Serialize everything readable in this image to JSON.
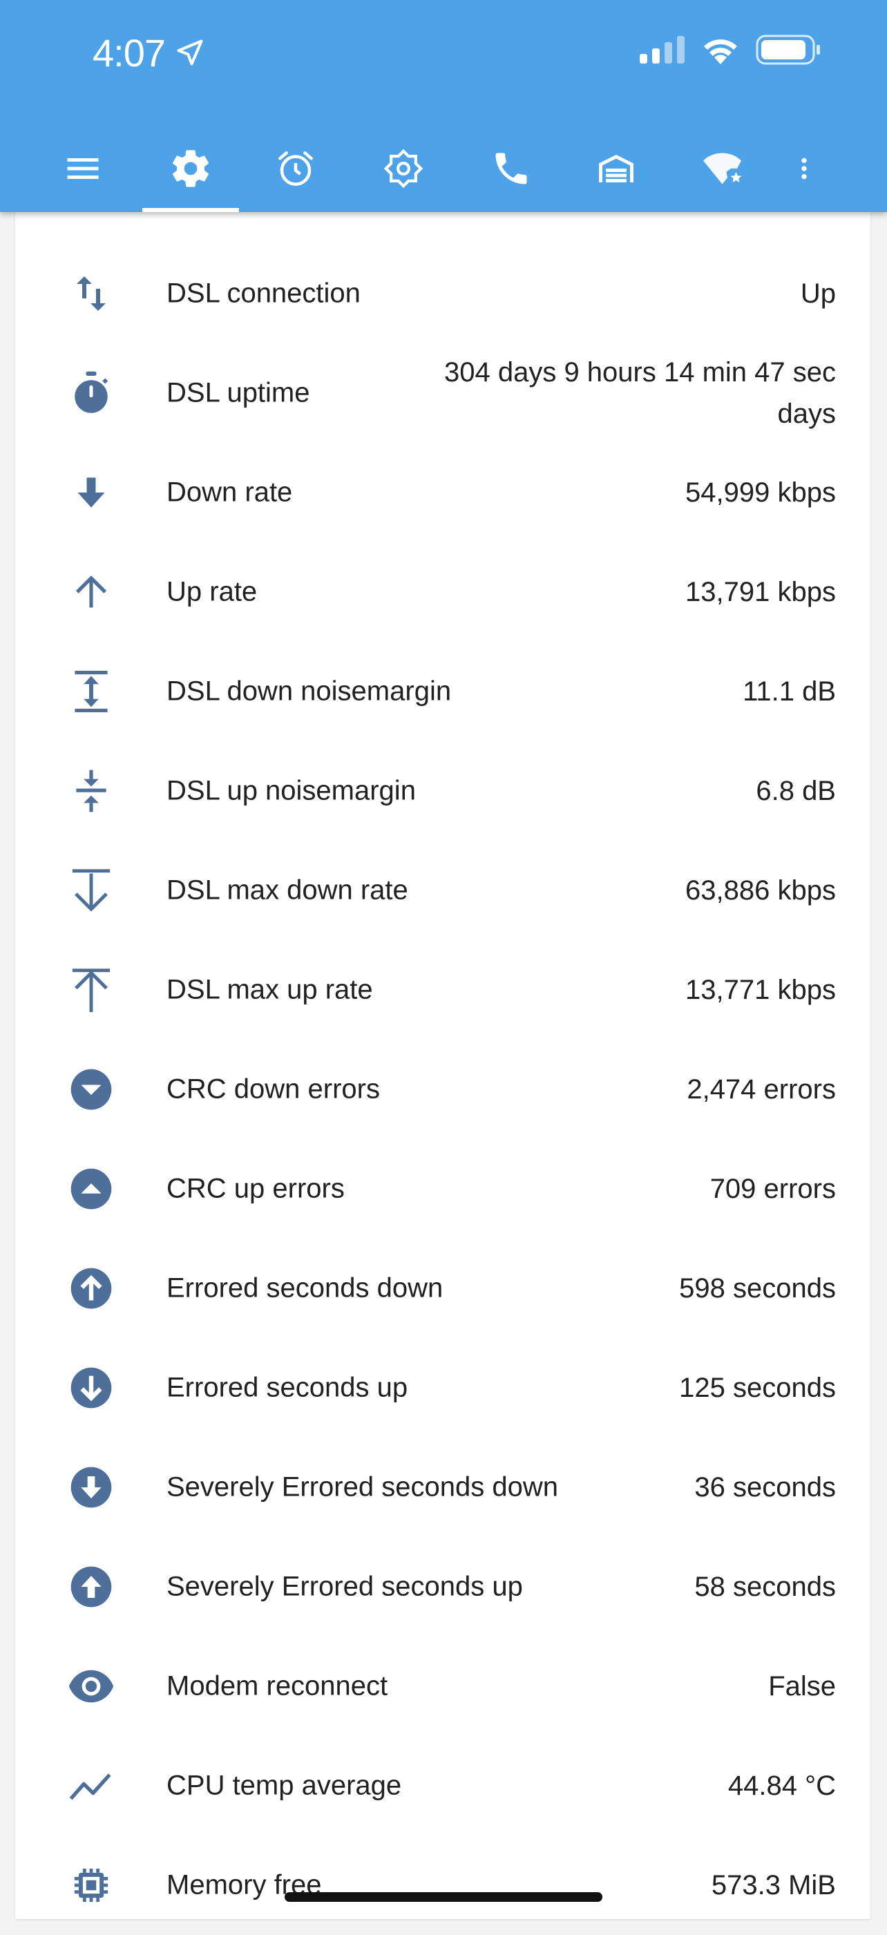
{
  "status_bar": {
    "time": "4:07"
  },
  "toolbar": {
    "icons": [
      "menu-icon",
      "settings-icon",
      "alarm-icon",
      "brightness-icon",
      "phone-icon",
      "garage-icon",
      "wifi-star-icon",
      "more-vert-icon"
    ],
    "active_index": 1
  },
  "colors": {
    "header": "#4da2e8",
    "icon": "#4f6f9b",
    "text": "#212121"
  },
  "entities": [
    {
      "icon": "swap-vertical-icon",
      "name": "DSL connection",
      "value": "Up"
    },
    {
      "icon": "timer-icon",
      "name": "DSL uptime",
      "value": "304 days 9 hours 14 min 47 sec",
      "value_line2": "days"
    },
    {
      "icon": "arrow-down-bold-icon",
      "name": "Down rate",
      "value": "54,999 kbps"
    },
    {
      "icon": "arrow-up-icon",
      "name": "Up rate",
      "value": "13,791 kbps"
    },
    {
      "icon": "arrow-expand-vertical-icon",
      "name": "DSL down noisemargin",
      "value": "11.1 dB"
    },
    {
      "icon": "arrow-collapse-vertical-icon",
      "name": "DSL up noisemargin",
      "value": "6.8 dB"
    },
    {
      "icon": "arrow-collapse-down-icon",
      "name": "DSL max down rate",
      "value": "63,886 kbps"
    },
    {
      "icon": "arrow-collapse-up-icon",
      "name": "DSL max up rate",
      "value": "13,771 kbps"
    },
    {
      "icon": "chevron-down-circle-icon",
      "name": "CRC down errors",
      "value": "2,474 errors"
    },
    {
      "icon": "chevron-up-circle-icon",
      "name": "CRC up errors",
      "value": "709 errors"
    },
    {
      "icon": "arrow-up-circle-icon",
      "name": "Errored seconds down",
      "value": "598 seconds"
    },
    {
      "icon": "arrow-down-circle-icon",
      "name": "Errored seconds up",
      "value": "125 seconds"
    },
    {
      "icon": "arrow-down-bold-circle-icon",
      "name": "Severely Errored seconds down",
      "value": "36 seconds"
    },
    {
      "icon": "arrow-up-bold-circle-icon",
      "name": "Severely Errored seconds up",
      "value": "58 seconds"
    },
    {
      "icon": "eye-icon",
      "name": "Modem reconnect",
      "value": "False"
    },
    {
      "icon": "chart-line-icon",
      "name": "CPU temp average",
      "value": "44.84 °C"
    },
    {
      "icon": "chip-icon",
      "name": "Memory free",
      "value": "573.3 MiB"
    }
  ]
}
